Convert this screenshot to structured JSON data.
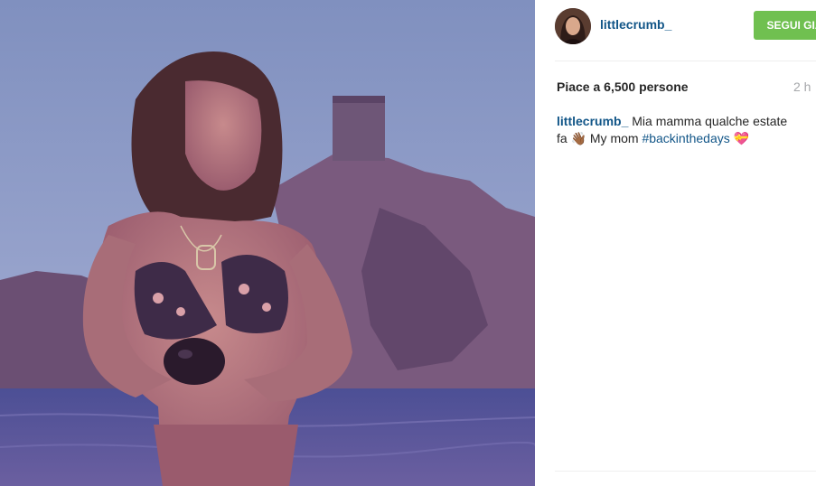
{
  "post": {
    "username": "littlecrumb_",
    "follow_label": "SEGUI GIÀ",
    "likes_prefix": "Piace a",
    "likes_count": "6,500",
    "likes_suffix": "persone",
    "time": "2 h",
    "caption": {
      "username": "littlecrumb_",
      "text": "Mia mamma qualche estate fa 👋🏾 My mom",
      "hashtag": "#backinthedays",
      "emoji": "💝"
    }
  },
  "icons": {
    "avatar": "avatar-image",
    "photo": "post-photo"
  }
}
